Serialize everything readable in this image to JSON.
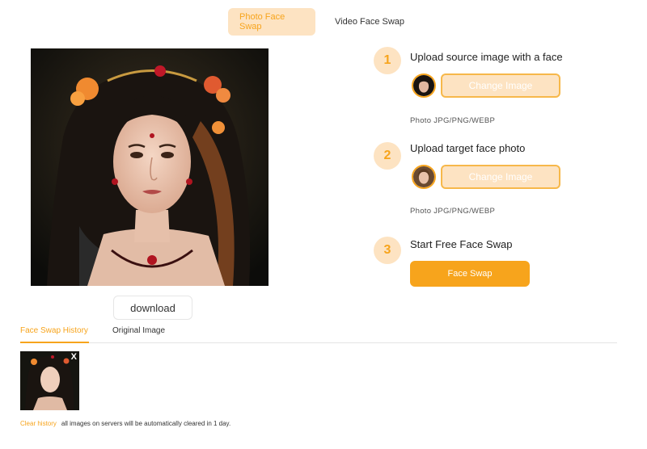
{
  "top_tabs": [
    {
      "label": "Photo Face Swap",
      "active": true
    },
    {
      "label": "Video Face Swap",
      "active": false
    }
  ],
  "result": {
    "image_description_icon": "portrait-image",
    "download_label": "download"
  },
  "steps": [
    {
      "number": "1",
      "title": "Upload source image with a face",
      "button_label": "Change Image",
      "format_hint": "Photo JPG/PNG/WEBP"
    },
    {
      "number": "2",
      "title": "Upload target face photo",
      "button_label": "Change Image",
      "format_hint": "Photo JPG/PNG/WEBP"
    },
    {
      "number": "3",
      "title": "Start Free Face Swap",
      "button_label": "Face Swap"
    }
  ],
  "bottom_tabs": [
    {
      "label": "Face Swap History",
      "active": true
    },
    {
      "label": "Original Image",
      "active": false
    }
  ],
  "history": {
    "close_glyph": "X",
    "clear_label": "Clear history",
    "note": "all images on servers will be automatically cleared in 1 day."
  },
  "colors": {
    "accent": "#f7a41c",
    "accent_light": "#fde3c2"
  }
}
